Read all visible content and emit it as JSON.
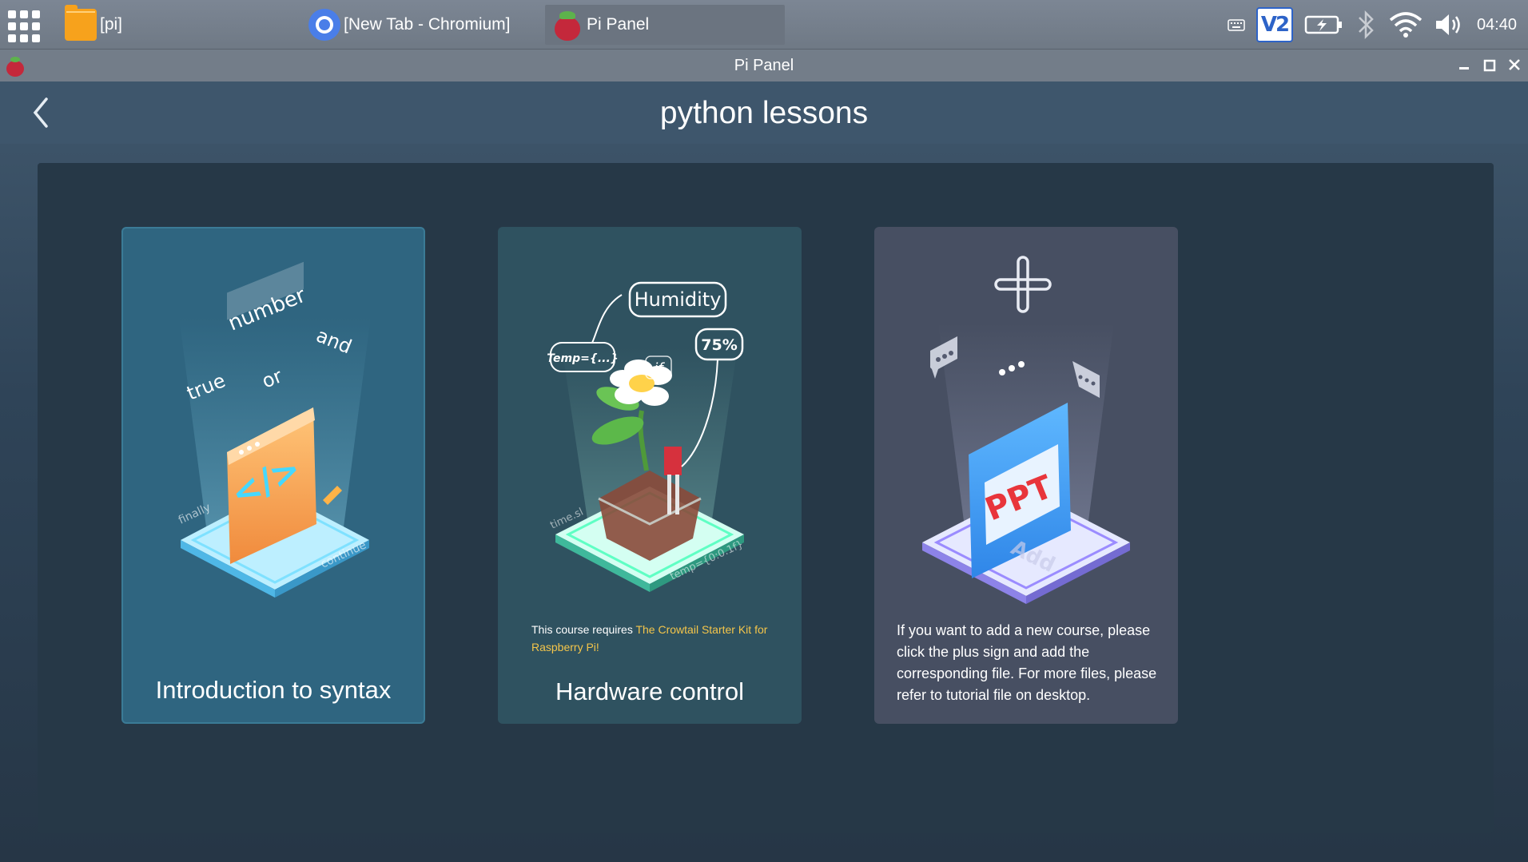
{
  "taskbar": {
    "tasks": [
      {
        "label": "[pi]",
        "icon": "folder-icon"
      },
      {
        "label": "[New Tab - Chromium]",
        "icon": "chromium-icon"
      },
      {
        "label": "Pi Panel",
        "icon": "raspberry-icon"
      }
    ],
    "vnc_label": "V2",
    "clock": "04:40"
  },
  "window": {
    "title": "Pi Panel"
  },
  "app": {
    "title": "python lessons",
    "cards": [
      {
        "title": "Introduction to syntax",
        "art_words": [
          "number",
          "and",
          "true",
          "or",
          "finally",
          "continue"
        ]
      },
      {
        "title": "Hardware control",
        "art_words": [
          "Humidity",
          "75%",
          "Temp={...}",
          "if",
          "time.sl",
          "temp={0:0.1f}"
        ],
        "note_prefix": "This course requires ",
        "note_highlight": "The Crowtail Starter Kit for Raspberry Pi!"
      },
      {
        "description": "If you want to add a new course, please click the plus sign and add the corresponding file. For more files, please refer to tutorial file on desktop.",
        "art_words": [
          "PPT",
          "Add"
        ]
      }
    ]
  },
  "colors": {
    "accent_yellow": "#f4c54a",
    "card_syntax": "#2f6580",
    "card_hardware": "#2f5260",
    "card_add": "#474f62"
  }
}
